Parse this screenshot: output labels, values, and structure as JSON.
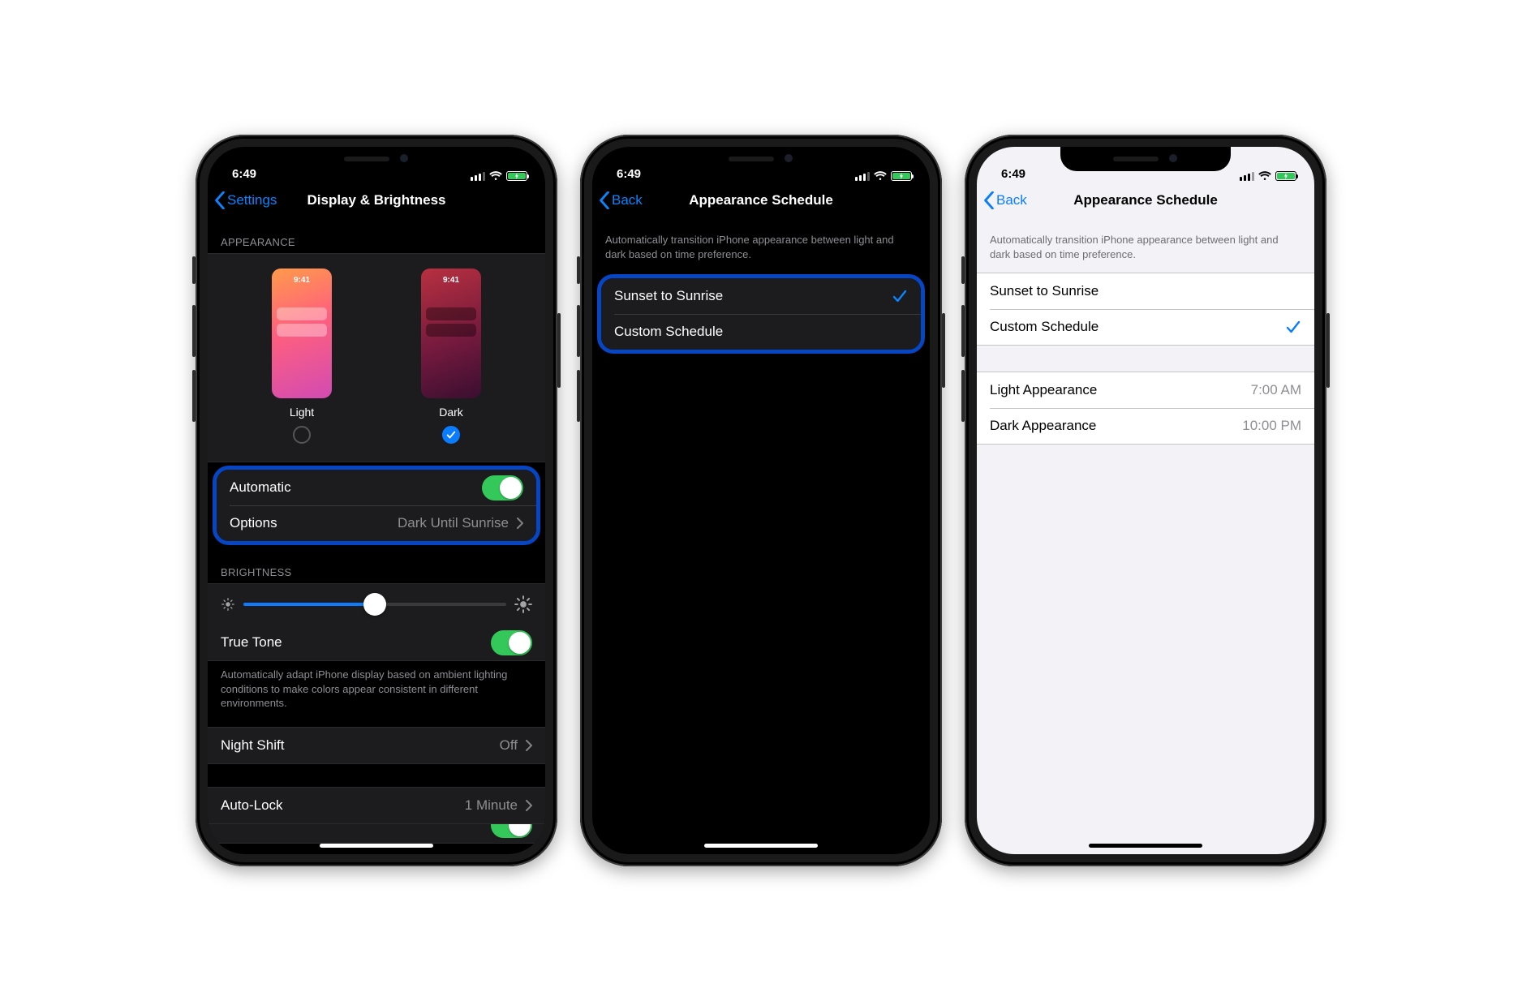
{
  "statusbar": {
    "time": "6:49"
  },
  "preview_time": "9:41",
  "phone1": {
    "nav": {
      "back": "Settings",
      "title": "Display & Brightness"
    },
    "appearance_header": "APPEARANCE",
    "options": {
      "light": "Light",
      "dark": "Dark",
      "selected": "dark"
    },
    "automatic": {
      "label": "Automatic",
      "on": true
    },
    "options_row": {
      "label": "Options",
      "value": "Dark Until Sunrise"
    },
    "brightness_header": "BRIGHTNESS",
    "brightness_pct": 50,
    "truetone": {
      "label": "True Tone",
      "on": true
    },
    "truetone_footer": "Automatically adapt iPhone display based on ambient lighting conditions to make colors appear consistent in different environments.",
    "nightshift": {
      "label": "Night Shift",
      "value": "Off"
    },
    "autolock": {
      "label": "Auto-Lock",
      "value": "1 Minute"
    }
  },
  "phone2": {
    "nav": {
      "back": "Back",
      "title": "Appearance Schedule"
    },
    "intro": "Automatically transition iPhone appearance between light and dark based on time preference.",
    "row1": "Sunset to Sunrise",
    "row2": "Custom Schedule",
    "selected": "row1"
  },
  "phone3": {
    "nav": {
      "back": "Back",
      "title": "Appearance Schedule"
    },
    "intro": "Automatically transition iPhone appearance between light and dark based on time preference.",
    "row1": "Sunset to Sunrise",
    "row2": "Custom Schedule",
    "selected": "row2",
    "light_label": "Light Appearance",
    "light_value": "7:00 AM",
    "dark_label": "Dark Appearance",
    "dark_value": "10:00 PM"
  }
}
